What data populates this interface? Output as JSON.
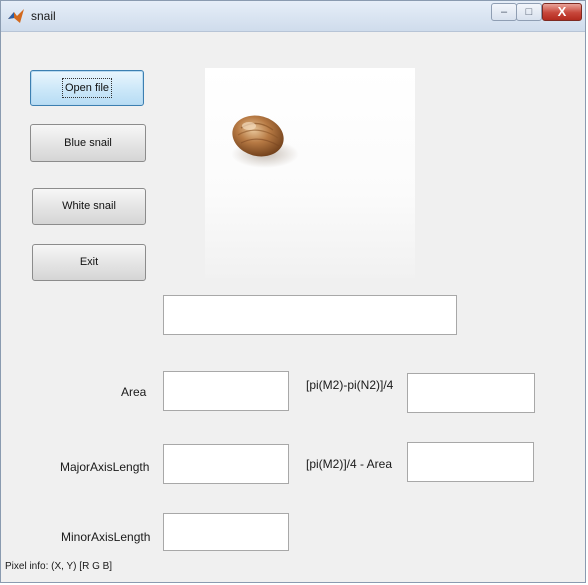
{
  "window": {
    "title": "snail",
    "controls": {
      "minimize": "–",
      "maximize": "□",
      "close": "X"
    }
  },
  "buttons": {
    "open_file": "Open file",
    "blue_snail": "Blue snail",
    "white_snail": "White snail",
    "exit": "Exit"
  },
  "image": {
    "subject": "snail-shell"
  },
  "fields": {
    "result": "",
    "area": "",
    "major_axis_length": "",
    "minor_axis_length": "",
    "ellipse_diff": "",
    "ellipse_minus_area": ""
  },
  "labels": {
    "area": "Area",
    "major_axis_length": "MajorAxisLength",
    "minor_axis_length": "MinorAxisLength",
    "ellipse_diff": "[pi(M2)-pi(N2)]/4",
    "ellipse_minus_area": "[pi(M2)]/4 - Area"
  },
  "status": {
    "pixel_info": "Pixel info: (X, Y)  [R G B]"
  },
  "colors": {
    "focus_accent": "#3c7fb1",
    "close_red": "#c7463a"
  }
}
